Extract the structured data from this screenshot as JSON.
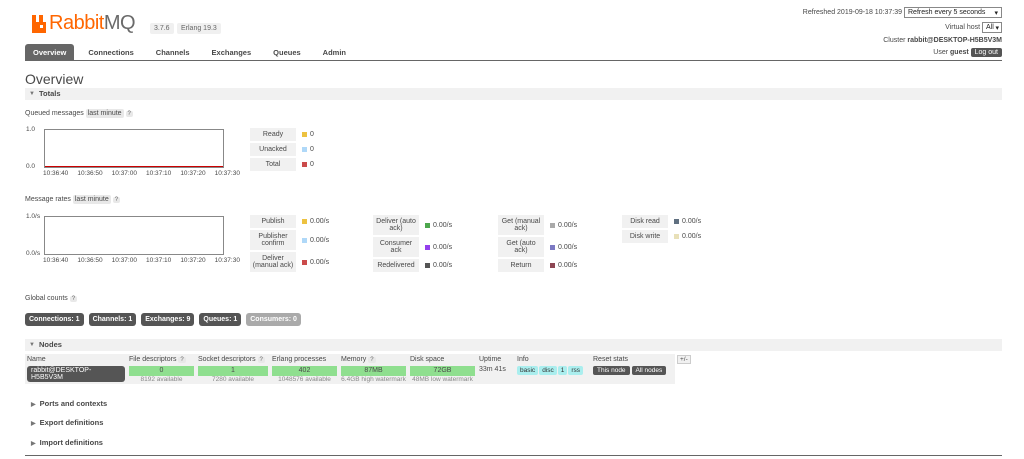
{
  "header": {
    "logo_text": "Rabbit",
    "logo_text_bold": "MQ",
    "version": "3.7.6",
    "erlang": "Erlang 19.3",
    "refreshed": "Refreshed 2019-09-18 10:37:39",
    "refresh_select": "Refresh every 5 seconds",
    "vhost_label": "Virtual host",
    "vhost_select": "All",
    "cluster_label": "Cluster",
    "cluster_name": "rabbit@DESKTOP-H5B5V3M",
    "user_label": "User",
    "user_name": "guest",
    "logout": "Log out"
  },
  "tabs": [
    "Overview",
    "Connections",
    "Channels",
    "Exchanges",
    "Queues",
    "Admin"
  ],
  "page_title": "Overview",
  "totals": {
    "heading": "Totals",
    "queued_label": "Queued messages",
    "queued_range": "last minute",
    "help": "?",
    "queued_chart": {
      "ymax": "1.0",
      "ymin": "0.0"
    },
    "queued_legend": [
      {
        "label": "Ready",
        "value": "0",
        "color": "#edc240"
      },
      {
        "label": "Unacked",
        "value": "0",
        "color": "#afd8f8"
      },
      {
        "label": "Total",
        "value": "0",
        "color": "#cb4b4b"
      }
    ],
    "rates_label": "Message rates",
    "rates_range": "last minute",
    "rates_chart": {
      "ymax": "1.0/s",
      "ymin": "0.0/s"
    },
    "rates_col1": [
      {
        "label": "Publish",
        "value": "0.00/s",
        "color": "#edc240"
      },
      {
        "label": "Publisher confirm",
        "value": "0.00/s",
        "color": "#afd8f8"
      },
      {
        "label": "Deliver (manual ack)",
        "value": "0.00/s",
        "color": "#cb4b4b"
      }
    ],
    "rates_col2": [
      {
        "label": "Deliver (auto ack)",
        "value": "0.00/s",
        "color": "#4da74d"
      },
      {
        "label": "Consumer ack",
        "value": "0.00/s",
        "color": "#9440ed"
      },
      {
        "label": "Redelivered",
        "value": "0.00/s",
        "color": "#555555"
      }
    ],
    "rates_col3": [
      {
        "label": "Get (manual ack)",
        "value": "0.00/s",
        "color": "#aaaaaa"
      },
      {
        "label": "Get (auto ack)",
        "value": "0.00/s",
        "color": "#7c79c3"
      },
      {
        "label": "Return",
        "value": "0.00/s",
        "color": "#8d4653"
      }
    ],
    "rates_col4": [
      {
        "label": "Disk read",
        "value": "0.00/s",
        "color": "#607080"
      },
      {
        "label": "Disk write",
        "value": "0.00/s",
        "color": "#e8e0b8"
      }
    ]
  },
  "x_ticks": [
    "10:36:40",
    "10:36:50",
    "10:37:00",
    "10:37:10",
    "10:37:20",
    "10:37:30"
  ],
  "global_counts": {
    "label": "Global counts",
    "items": [
      {
        "text": "Connections: 1",
        "dim": false
      },
      {
        "text": "Channels: 1",
        "dim": false
      },
      {
        "text": "Exchanges: 9",
        "dim": false
      },
      {
        "text": "Queues: 1",
        "dim": false
      },
      {
        "text": "Consumers: 0",
        "dim": true
      }
    ]
  },
  "nodes": {
    "heading": "Nodes",
    "columns": [
      "Name",
      "File descriptors",
      "Socket descriptors",
      "Erlang processes",
      "Memory",
      "Disk space",
      "Uptime",
      "Info",
      "Reset stats"
    ],
    "help_columns": [
      1,
      2,
      4
    ],
    "plus_minus": "+/-",
    "row": {
      "name": "rabbit@DESKTOP-H5B5V3M",
      "fd": "0",
      "fd_sub": "8192 available",
      "sd": "1",
      "sd_sub": "7280 available",
      "ep": "402",
      "ep_sub": "1048576 available",
      "mem": "87MB",
      "mem_sub": "6.4GB high watermark",
      "disk": "72GB",
      "disk_sub": "48MB low watermark",
      "uptime": "33m 41s",
      "info": [
        "basic",
        "disc",
        "1",
        "rss"
      ],
      "reset_node": "This node",
      "reset_all": "All nodes"
    }
  },
  "collapsed": [
    "Ports and contexts",
    "Export definitions",
    "Import definitions"
  ]
}
